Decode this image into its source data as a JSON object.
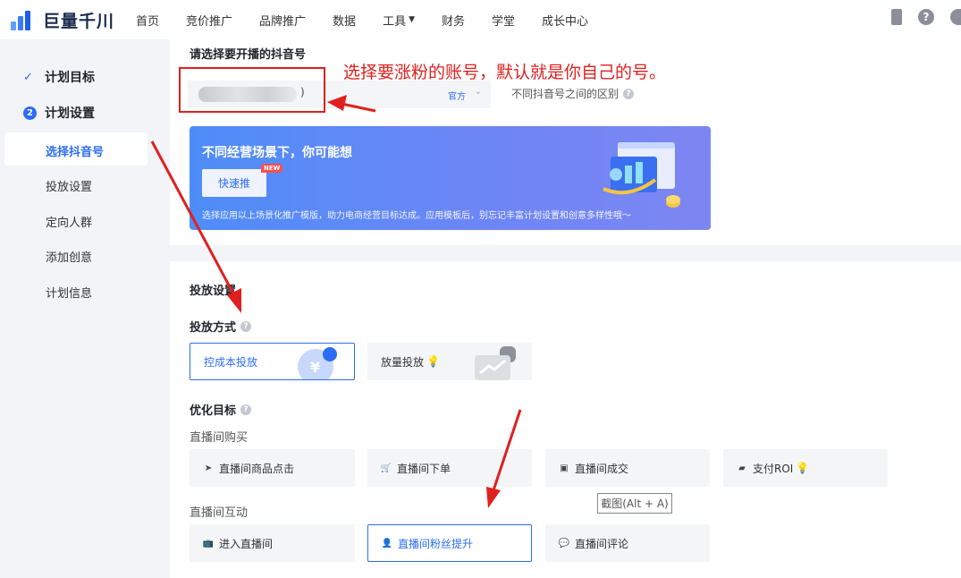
{
  "brand": {
    "name": "巨量千川"
  },
  "nav": [
    "首页",
    "竞价推广",
    "品牌推广",
    "数据",
    "工具",
    "财务",
    "学堂",
    "成长中心"
  ],
  "nav_caret_item": "工具",
  "top_icons": [
    "phone-icon",
    "help-icon",
    "add-icon"
  ],
  "sidebar": {
    "step1": "计划目标",
    "step2_num": "2",
    "step2": "计划设置",
    "subs": [
      "选择抖音号",
      "投放设置",
      "定向人群",
      "添加创意",
      "计划信息"
    ]
  },
  "account": {
    "title": "请选择要开播的抖音号",
    "selected_suffix": ")",
    "official_tag": "官方",
    "diff_link": "不同抖音号之间的区别"
  },
  "annotation": "选择要涨粉的账号，默认就是你自己的号。",
  "banner": {
    "title": "不同经营场景下，你可能想",
    "button": "快速推",
    "new_tag": "NEW",
    "desc": "选择应用以上场景化推广模版，助力电商经营目标达成。应用模板后，别忘记丰富计划设置和创意多样性哦～"
  },
  "delivery": {
    "title": "投放设置",
    "mode_label": "投放方式",
    "modes": [
      "控成本投放",
      "放量投放"
    ],
    "mode_icon_text": "¥"
  },
  "optimize": {
    "label": "优化目标",
    "group1": "直播间购买",
    "group1_items": [
      "直播间商品点击",
      "直播间下单",
      "直播间成交",
      "支付ROI"
    ],
    "group2": "直播间互动",
    "group2_items": [
      "进入直播间",
      "直播间粉丝提升",
      "直播间评论"
    ]
  },
  "tooltip": "截图(Alt + A)",
  "colors": {
    "accent": "#2b6cf6",
    "annotation": "#e02020"
  }
}
